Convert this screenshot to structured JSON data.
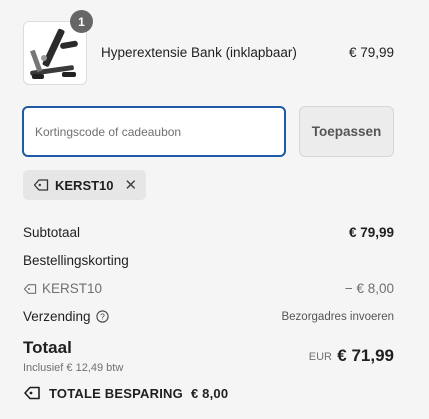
{
  "item": {
    "quantity": "1",
    "name": "Hyperextensie Bank (inklapbaar)",
    "price": "€ 79,99",
    "image_icon": "hyperextension-bench-product-image"
  },
  "discount": {
    "placeholder": "Kortingscode of cadeaubon",
    "apply_label": "Toepassen"
  },
  "applied_code": {
    "code": "KERST10",
    "icon": "tag-icon"
  },
  "summary": {
    "subtotal_label": "Subtotaal",
    "subtotal_value": "€ 79,99",
    "order_discount_label": "Bestellingskorting",
    "code_label": "KERST10",
    "code_value": "− € 8,00",
    "shipping_label": "Verzending",
    "shipping_value": "Bezorgadres invoeren"
  },
  "total": {
    "label": "Totaal",
    "tax_note": "Inclusief € 12,49 btw",
    "currency": "EUR",
    "amount": "€ 71,99"
  },
  "saving": {
    "label": "TOTALE BESPARING",
    "amount": "€ 8,00"
  },
  "colors": {
    "focus_border": "#1f5aa6",
    "badge": "#666666",
    "background": "#f5f5f5"
  }
}
